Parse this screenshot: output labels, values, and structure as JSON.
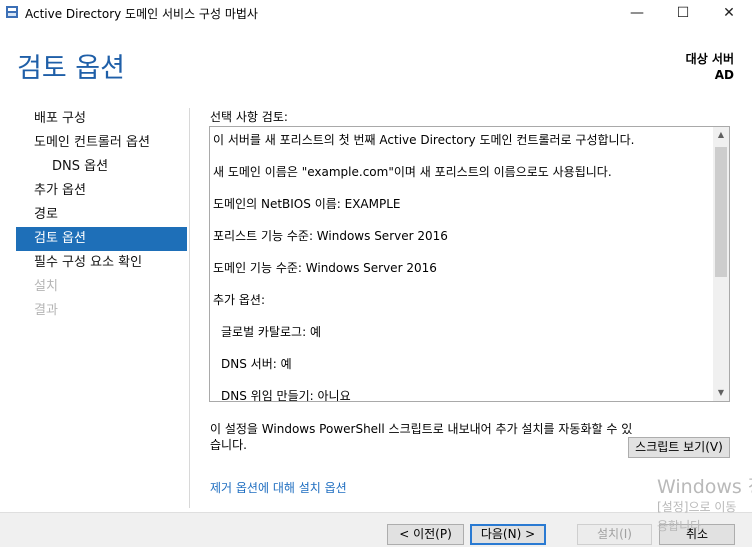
{
  "window": {
    "title": "Active Directory 도메인 서비스 구성 마법사",
    "minimize_glyph": "—",
    "maximize_glyph": "☐",
    "close_glyph": "✕"
  },
  "header": {
    "title": "검토 옵션",
    "target_label": "대상 서버",
    "target_server": "AD"
  },
  "sidebar": {
    "items": [
      {
        "label": "배포 구성",
        "state": "normal"
      },
      {
        "label": "도메인 컨트롤러 옵션",
        "state": "normal"
      },
      {
        "label": "DNS 옵션",
        "state": "sub"
      },
      {
        "label": "추가 옵션",
        "state": "normal"
      },
      {
        "label": "경로",
        "state": "normal"
      },
      {
        "label": "검토 옵션",
        "state": "active"
      },
      {
        "label": "필수 구성 요소 확인",
        "state": "normal"
      },
      {
        "label": "설치",
        "state": "disabled"
      },
      {
        "label": "결과",
        "state": "disabled"
      }
    ]
  },
  "review": {
    "label": "선택 사항 검토:",
    "lines": [
      "이 서버를 새 포리스트의 첫 번째 Active Directory 도메인 컨트롤러로 구성합니다.",
      "새 도메인 이름은 \"example.com\"이며 새 포리스트의 이름으로도 사용됩니다.",
      "도메인의 NetBIOS 이름: EXAMPLE",
      "포리스트 기능 수준: Windows Server 2016",
      "도메인 기능 수준: Windows Server 2016",
      "추가 옵션:",
      "글로벌 카탈로그: 예",
      "DNS 서버: 예",
      "DNS 위임 만들기: 아니요"
    ]
  },
  "powershell": {
    "note": "이 설정을 Windows PowerShell 스크립트로 내보내어 추가 설치를 자동화할 수 있습니다.",
    "view_script_button": "스크립트 보기(V)"
  },
  "links": {
    "more_about": "제거 옵션에 대해 설치 옵션"
  },
  "footer": {
    "prev_button": "< 이전(P)",
    "next_button": "다음(N) >",
    "install_button": "설치(I)",
    "cancel_button": "취소"
  },
  "watermark": {
    "line1": "Windows 정",
    "line2": "[설정]으로 이동",
    "line3": "용합니다."
  }
}
